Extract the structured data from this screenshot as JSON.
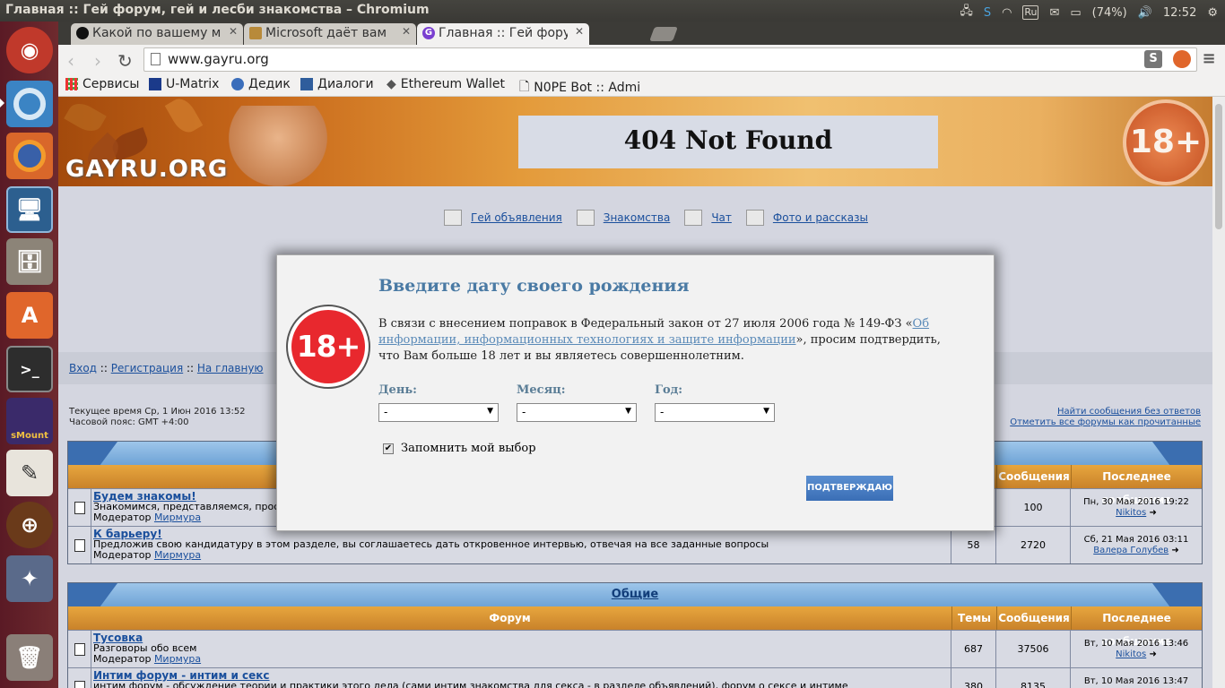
{
  "topbar": {
    "window_title": "Главная :: Гей форум, гей и лесби знакомства – Chromium",
    "keyboard": "Ru",
    "battery": "(74%)",
    "time": "12:52"
  },
  "launcher": {
    "items": [
      "ubuntu-dash",
      "chromium",
      "firefox",
      "remote-desktop",
      "files",
      "software-center",
      "terminal",
      "smount",
      "text-editor",
      "game",
      "counter-strike",
      "trash"
    ],
    "smount_label": "sMount"
  },
  "tabs": [
    {
      "label": "Какой по вашему м",
      "favicon": "BHF",
      "active": false
    },
    {
      "label": "Microsoft даёт вам",
      "favicon": "hat",
      "active": false
    },
    {
      "label": "Главная :: Гей форум",
      "favicon": "G",
      "active": true
    }
  ],
  "toolbar": {
    "url": "www.gayru.org"
  },
  "bookmarks": [
    "Сервисы",
    "U-Matrix",
    "Дедик",
    "Диалоги",
    "Ethereum Wallet",
    "N0PE Bot :: Admi"
  ],
  "banner": {
    "logo": "GAYRU.ORG",
    "not_found": "404 Not Found",
    "age_badge": "18+"
  },
  "nav": {
    "ads": "Гей объявления",
    "dating": "Знакомства",
    "chat": "Чат",
    "photos": "Фото и рассказы"
  },
  "auth": {
    "login": "Вход",
    "sep1": " :: ",
    "register": "Регистрация",
    "sep2": " :: ",
    "home": "На главную"
  },
  "info": {
    "time": "Текущее время Ср, 1 Июн 2016 13:52",
    "tz": "Часовой пояс: GMT +4:00",
    "unanswered": "Найти сообщения без ответов",
    "mark_read": "Отметить все форумы как прочитанные"
  },
  "columns": {
    "forum": "Форум",
    "topics": "Темы",
    "posts": "Сообщения",
    "last": "Последнее сообщение"
  },
  "block1": {
    "rows": [
      {
        "name": "Будем знакомы!",
        "desc": "Знакомимся, представляемся, проставл",
        "mod_label": "Модератор",
        "mod": "Мирмура",
        "topics": "",
        "posts": "100",
        "last_date": "Пн, 30 Мая 2016 19:22",
        "last_user": "Nikitos"
      },
      {
        "name": "К барьеру!",
        "desc": "Предложив свою кандидатуру в этом разделе, вы соглашаетесь дать откровенное интервью, отвечая на все заданные вопросы",
        "mod_label": "Модератор",
        "mod": "Мирмура",
        "topics": "58",
        "posts": "2720",
        "last_date": "Сб, 21 Мая 2016 03:11",
        "last_user": "Валера Голубев"
      }
    ]
  },
  "block2": {
    "title": "Общие",
    "rows": [
      {
        "name": "Тусовка",
        "desc": "Разговоры обо всем",
        "mod_label": "Модератор",
        "mod": "Мирмура",
        "topics": "687",
        "posts": "37506",
        "last_date": "Вт, 10 Мая 2016 13:46",
        "last_user": "Nikitos"
      },
      {
        "name": "Интим форум - интим и секс",
        "desc": "интим форум - обсуждение теории и практики этого дела (сами интим знакомства для секса - в разделе объявлений), форум о сексе и интиме",
        "mod_label": "",
        "mod": "",
        "topics": "380",
        "posts": "8135",
        "last_date": "Вт, 10 Мая 2016 13:47",
        "last_user": ""
      }
    ]
  },
  "modal": {
    "badge": "18+",
    "title": "Введите дату своего рождения",
    "msg_before": "В связи с внесением поправок в Федеральный закон от 27 июля 2006 года № 149-ФЗ «",
    "msg_link": "Об информации, информационных технологиях и защите информации",
    "msg_after": "», просим подтвердить, что Вам больше 18 лет и вы являетесь совершеннолетним.",
    "day_label": "День:",
    "month_label": "Месяц:",
    "year_label": "Год:",
    "day_value": "-",
    "month_value": "-",
    "year_value": "-",
    "remember": "Запомнить мой выбор",
    "confirm": "ПОДТВЕРЖДАЮ"
  },
  "colors": {
    "modal_title": "#4a7aa4",
    "confirm_button": "#3a6eb6",
    "badge_red": "#e8282e",
    "column_header": "#c9822a",
    "category_header": "#6ea3d6"
  }
}
